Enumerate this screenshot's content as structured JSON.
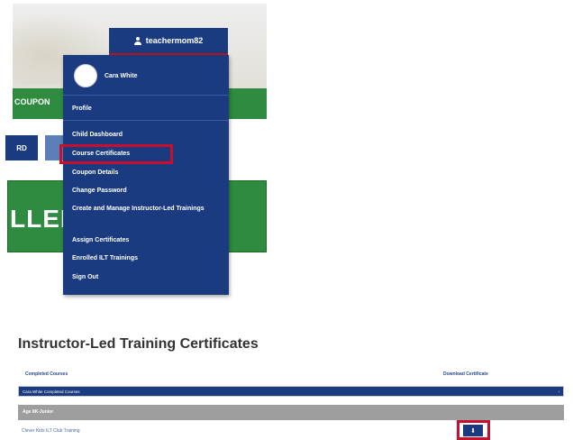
{
  "header": {
    "username": "teachermom82"
  },
  "background": {
    "coupon_label": "COUPON",
    "left_button_label": "RD",
    "enrolled_fragment": "LLED"
  },
  "dropdown": {
    "user_display_name": "Cara White",
    "items": [
      {
        "label": "Profile"
      },
      {
        "label": "Child Dashboard"
      },
      {
        "label": "Course Certificates"
      },
      {
        "label": "Coupon Details"
      },
      {
        "label": "Change Password"
      },
      {
        "label": "Create and Manage Instructor-Led Trainings"
      },
      {
        "label": "Assign Certificates"
      },
      {
        "label": "Enrolled ILT Trainings"
      },
      {
        "label": "Sign Out"
      }
    ],
    "highlighted_item": "Course Certificates"
  },
  "certificates": {
    "title": "Instructor-Led Training Certificates",
    "columns": [
      "Completed Courses",
      "Download Certificate"
    ],
    "group_row": "Cara White Completed Courses",
    "subgroup_row": "Age 8K-Junior",
    "course_row": "Clever Kids ILT Club Training",
    "download_icon": "download-icon"
  },
  "colors": {
    "navy": "#1b3b80",
    "green": "#2e8b3f",
    "highlight_red": "#c8102e",
    "grey_row": "#9e9e9e"
  }
}
